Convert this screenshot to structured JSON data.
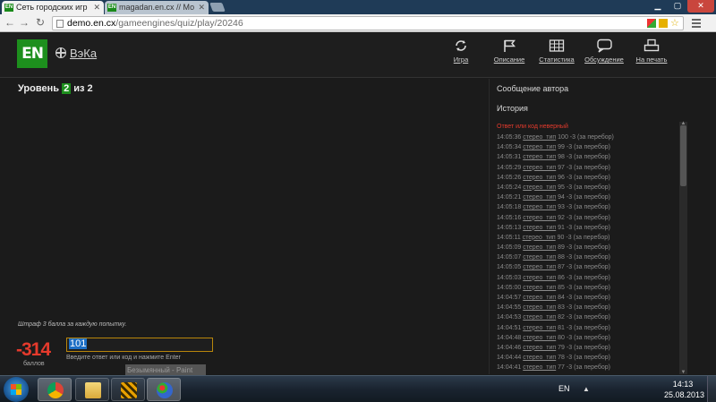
{
  "browser": {
    "tabs": [
      {
        "title": "Сеть городских игр",
        "favicon": "en-logo"
      },
      {
        "title": "magadan.en.cx // Мо",
        "favicon": "en-logo"
      }
    ],
    "url_host": "demo.en.cx",
    "url_path": "/gameengines/quiz/play/20246"
  },
  "site": {
    "logo_text": "EN",
    "team_name": "ВэКа",
    "nav": [
      {
        "label": "Игра",
        "icon": "refresh-icon"
      },
      {
        "label": "Описание",
        "icon": "flag-icon"
      },
      {
        "label": "Статистика",
        "icon": "grid-table-icon"
      },
      {
        "label": "Обсуждение",
        "icon": "chat-bubble-icon"
      },
      {
        "label": "На печать",
        "icon": "printer-icon"
      }
    ]
  },
  "level": {
    "prefix": "Уровень",
    "current": "2",
    "of_text": "из 2"
  },
  "penalty_note": "Штраф 3 балла за каждую попытку.",
  "score": {
    "value": "-314",
    "label": "баллов"
  },
  "answer": {
    "value": "101",
    "hint": "Введите ответ или код и нажмите Enter"
  },
  "tooltip": "Безымянный - Paint",
  "sidebar": {
    "author_message": "Сообщение автора",
    "history_title": "История",
    "status": "Ответ или код неверный",
    "history": [
      {
        "time": "14:05:36",
        "user": "стерео_тип",
        "code": "100",
        "pts": "-3",
        "note": "(за перебор)"
      },
      {
        "time": "14:05:34",
        "user": "стерео_тип",
        "code": "99",
        "pts": "-3",
        "note": "(за перебор)"
      },
      {
        "time": "14:05:31",
        "user": "стерео_тип",
        "code": "98",
        "pts": "-3",
        "note": "(за перебор)"
      },
      {
        "time": "14:05:29",
        "user": "стерео_тип",
        "code": "97",
        "pts": "-3",
        "note": "(за перебор)"
      },
      {
        "time": "14:05:26",
        "user": "стерео_тип",
        "code": "96",
        "pts": "-3",
        "note": "(за перебор)"
      },
      {
        "time": "14:05:24",
        "user": "стерео_тип",
        "code": "95",
        "pts": "-3",
        "note": "(за перебор)"
      },
      {
        "time": "14:05:21",
        "user": "стерео_тип",
        "code": "94",
        "pts": "-3",
        "note": "(за перебор)"
      },
      {
        "time": "14:05:18",
        "user": "стерео_тип",
        "code": "93",
        "pts": "-3",
        "note": "(за перебор)"
      },
      {
        "time": "14:05:16",
        "user": "стерео_тип",
        "code": "92",
        "pts": "-3",
        "note": "(за перебор)"
      },
      {
        "time": "14:05:13",
        "user": "стерео_тип",
        "code": "91",
        "pts": "-3",
        "note": "(за перебор)"
      },
      {
        "time": "14:05:11",
        "user": "стерео_тип",
        "code": "90",
        "pts": "-3",
        "note": "(за перебор)"
      },
      {
        "time": "14:05:09",
        "user": "стерео_тип",
        "code": "89",
        "pts": "-3",
        "note": "(за перебор)"
      },
      {
        "time": "14:05:07",
        "user": "стерео_тип",
        "code": "88",
        "pts": "-3",
        "note": "(за перебор)"
      },
      {
        "time": "14:05:05",
        "user": "стерео_тип",
        "code": "87",
        "pts": "-3",
        "note": "(за перебор)"
      },
      {
        "time": "14:05:03",
        "user": "стерео_тип",
        "code": "86",
        "pts": "-3",
        "note": "(за перебор)"
      },
      {
        "time": "14:05:00",
        "user": "стерео_тип",
        "code": "85",
        "pts": "-3",
        "note": "(за перебор)"
      },
      {
        "time": "14:04:57",
        "user": "стерео_тип",
        "code": "84",
        "pts": "-3",
        "note": "(за перебор)"
      },
      {
        "time": "14:04:55",
        "user": "стерео_тип",
        "code": "83",
        "pts": "-3",
        "note": "(за перебор)"
      },
      {
        "time": "14:04:53",
        "user": "стерео_тип",
        "code": "82",
        "pts": "-3",
        "note": "(за перебор)"
      },
      {
        "time": "14:04:51",
        "user": "стерео_тип",
        "code": "81",
        "pts": "-3",
        "note": "(за перебор)"
      },
      {
        "time": "14:04:48",
        "user": "стерео_тип",
        "code": "80",
        "pts": "-3",
        "note": "(за перебор)"
      },
      {
        "time": "14:04:46",
        "user": "стерео_тип",
        "code": "79",
        "pts": "-3",
        "note": "(за перебор)"
      },
      {
        "time": "14:04:44",
        "user": "стерео_тип",
        "code": "78",
        "pts": "-3",
        "note": "(за перебор)"
      },
      {
        "time": "14:04:41",
        "user": "стерео_тип",
        "code": "77",
        "pts": "-3",
        "note": "(за перебор)"
      }
    ]
  },
  "taskbar": {
    "apps": [
      {
        "name": "chrome-icon"
      },
      {
        "name": "file-explorer-icon"
      },
      {
        "name": "media-player-icon"
      },
      {
        "name": "paint-icon"
      }
    ],
    "language": "EN",
    "time": "14:13",
    "date": "25.08.2013"
  },
  "colors": {
    "brand_green": "#1d8f1d",
    "error_red": "#e53a2c",
    "background": "#1b1b1b"
  }
}
